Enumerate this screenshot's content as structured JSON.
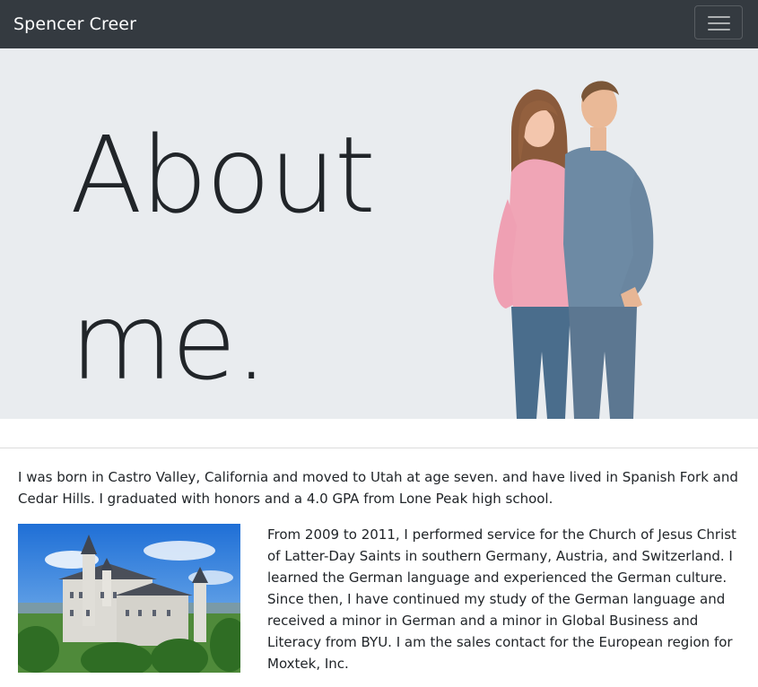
{
  "navbar": {
    "brand": "Spencer Creer",
    "toggle_icon": "hamburger-menu-icon"
  },
  "hero": {
    "title_line1": "About",
    "title_line2": "me.",
    "image": "couple-photo"
  },
  "content": {
    "intro": "I was born in Castro Valley, California and moved to Utah at age seven. and have lived in Spanish Fork and Cedar Hills. I graduated with honors and a 4.0 GPA from Lone Peak high school.",
    "image": "castle-photo",
    "service": "From 2009 to 2011, I performed service for the Church of Jesus Christ of Latter-Day Saints in southern Germany, Austria, and Switzerland. I learned the German language and experienced the German culture. Since then, I have continued my study of the German language and received a minor in German and a minor in Global Business and Literacy from BYU. I am the sales contact for the European region for Moxtek, Inc."
  },
  "colors": {
    "navbar_bg": "#343a40",
    "hero_bg": "#e9ecef",
    "text": "#212529"
  }
}
